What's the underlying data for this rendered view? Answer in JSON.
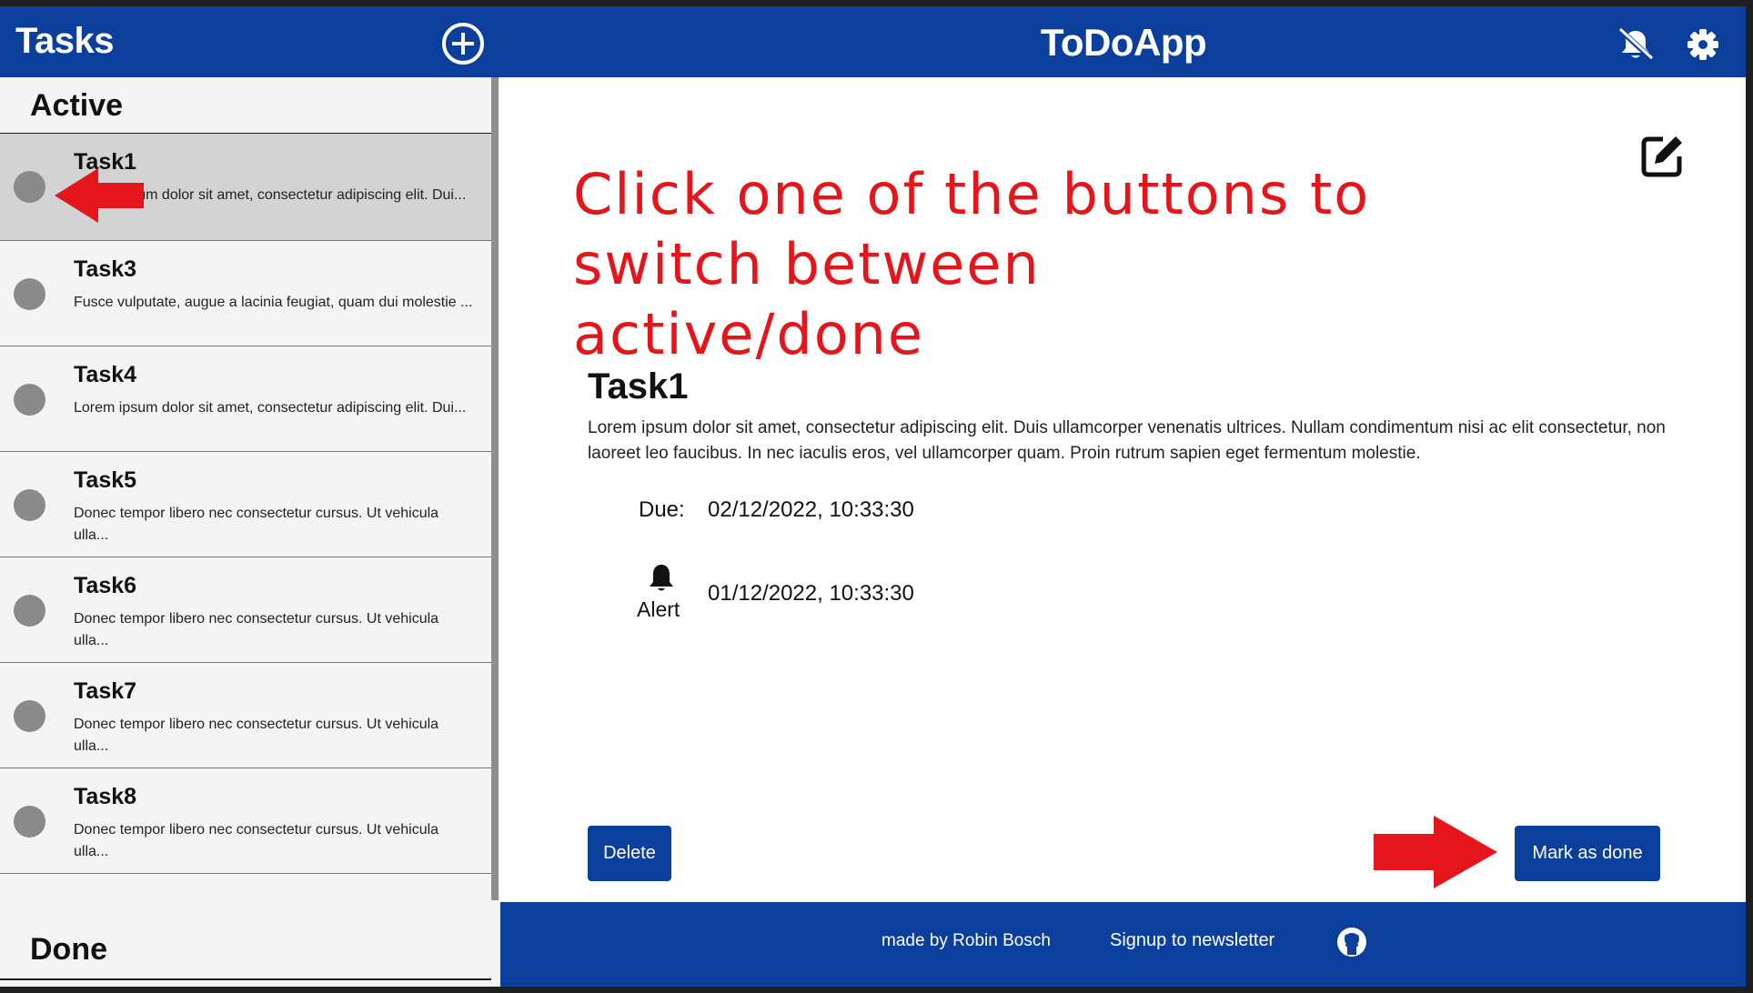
{
  "header": {
    "tasks_title": "Tasks",
    "app_title": "ToDoApp",
    "add_icon": "plus-circle-icon",
    "notifications_icon": "bell-slash-icon",
    "settings_icon": "gear-icon",
    "brand_color": "#0c3f9c"
  },
  "sidebar": {
    "active_heading": "Active",
    "done_heading": "Done",
    "tasks": [
      {
        "title": "Task1",
        "desc": "Lorem ipsum dolor sit amet, consectetur adipiscing elit. Dui...",
        "selected": true
      },
      {
        "title": "Task3",
        "desc": "Fusce vulputate, augue a lacinia feugiat, quam dui molestie ..."
      },
      {
        "title": "Task4",
        "desc": "Lorem ipsum dolor sit amet, consectetur adipiscing elit. Dui..."
      },
      {
        "title": "Task5",
        "desc": "Donec tempor libero nec consectetur cursus. Ut vehicula ulla..."
      },
      {
        "title": "Task6",
        "desc": "Donec tempor libero nec consectetur cursus. Ut vehicula ulla..."
      },
      {
        "title": "Task7",
        "desc": "Donec tempor libero nec consectetur cursus. Ut vehicula ulla..."
      },
      {
        "title": "Task8",
        "desc": "Donec tempor libero nec consectetur cursus. Ut vehicula ulla..."
      }
    ]
  },
  "main": {
    "hint_text": "Click one of the buttons to switch between active/done",
    "hint_color": "#e4161b",
    "edit_icon": "edit-icon",
    "task": {
      "title": "Task1",
      "description": "Lorem ipsum dolor sit amet, consectetur adipiscing elit. Duis ullamcorper venenatis ultrices. Nullam condimentum nisi ac elit consectetur, non laoreet leo faucibus. In nec iaculis eros, vel ullamcorper quam. Proin rutrum sapien eget fermentum molestie.",
      "due_label": "Due:",
      "due_value": "02/12/2022, 10:33:30",
      "alert_label": "Alert",
      "alert_value": "01/12/2022, 10:33:30"
    },
    "delete_label": "Delete",
    "mark_done_label": "Mark as done"
  },
  "footer": {
    "credit": "made by Robin Bosch",
    "newsletter": "Signup to newsletter",
    "github_icon": "github-icon"
  }
}
